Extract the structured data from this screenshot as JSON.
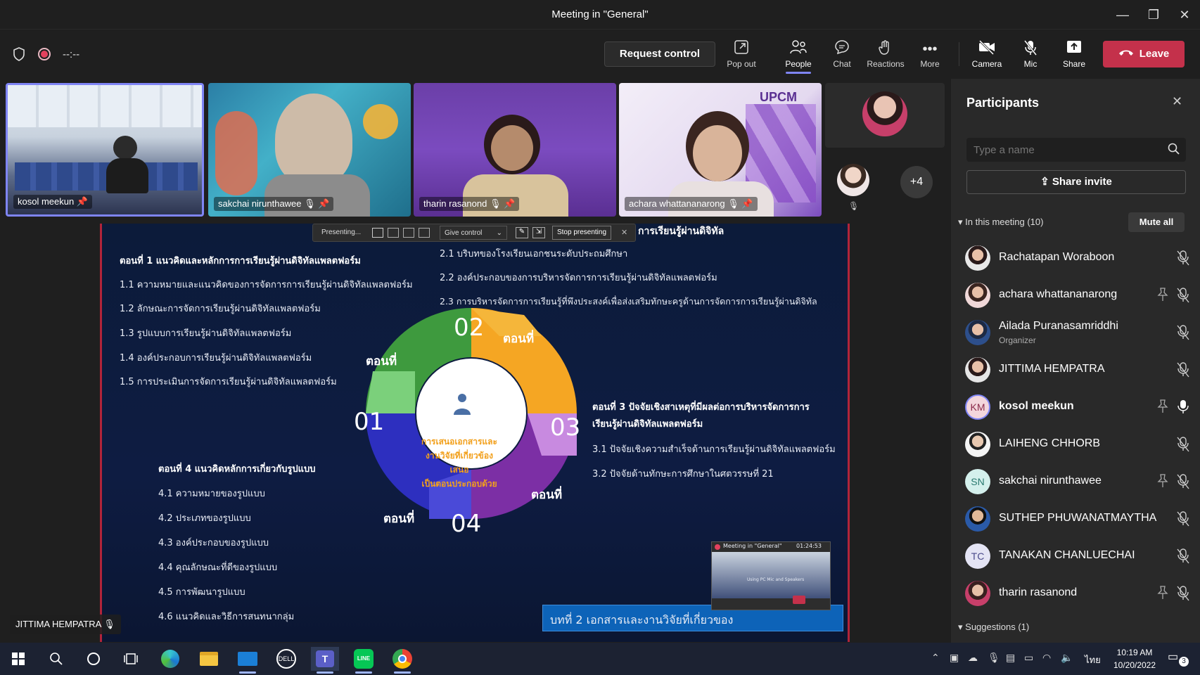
{
  "window": {
    "title": "Meeting in \"General\""
  },
  "toolbar": {
    "timer": "--:--",
    "request_control": "Request control",
    "pop_out": "Pop out",
    "people": "People",
    "chat": "Chat",
    "reactions": "Reactions",
    "more": "More",
    "camera": "Camera",
    "mic": "Mic",
    "share": "Share",
    "leave": "Leave",
    "colors": {
      "leave": "#c4314b",
      "accent": "#7f85f5"
    }
  },
  "videos": [
    {
      "name": "kosol meekun"
    },
    {
      "name": "sakchai nirunthawee"
    },
    {
      "name": "tharin rasanond"
    },
    {
      "name": "achara whattananarong"
    }
  ],
  "overflow_count": "+4",
  "presenting_bar": {
    "status": "Presenting...",
    "give_control": "Give control",
    "stop": "Stop presenting"
  },
  "slide": {
    "top_title": "การเรียนรู้ผ่านดิจิทัล",
    "part1_title": "ตอนที่ 1 แนวคิดและหลักการการเรียนรู้ผ่านดิจิทัลแพลตฟอร์ม",
    "part1_items": [
      "1.1 ความหมายและแนวคิดของการจัดการการเรียนรู้ผ่านดิจิทัลแพลตฟอร์ม",
      "1.2 ลักษณะการจัดการเรียนรู้ผ่านดิจิทัลแพลตฟอร์ม",
      "1.3 รูปแบบการเรียนรู้ผ่านดิจิทัลแพลตฟอร์ม",
      "1.4 องค์ประกอบการเรียนรู้ผ่านดิจิทัลแพลตฟอร์ม",
      "1.5 การประเมินการจัดการเรียนรู้ผ่านดิจิทัลแพลตฟอร์ม"
    ],
    "part2_items": [
      "2.1 บริบทของโรงเรียนเอกชนระดับประถมศึกษา",
      "2.2 องค์ประกอบของการบริหารจัดการการเรียนรู้ผ่านดิจิทัลแพลตฟอร์ม",
      "2.3 การบริหารจัดการการเรียนรู้ที่พึงประสงค์เพื่อส่งเสริมทักษะครูด้านการจัดการการเรียนรู้ผ่านดิจิทัล"
    ],
    "part3_title_line1": "ตอนที่ 3 ปัจจัยเชิงสาเหตุที่มีผลต่อการบริหารจัดการการ",
    "part3_title_line2": "เรียนรู้ผ่านดิจิทัลแพลตฟอร์ม",
    "part3_items": [
      "3.1 ปัจจัยเชิงความสำเร็จด้านการเรียนรู้ผ่านดิจิทัลแพลตฟอร์ม",
      "3.2 ปัจจัยด้านทักษะการศึกษาในศตวรรษที่ 21"
    ],
    "part4_title": "ตอนที่ 4 แนวคิดหลักการเกี่ยวกับรูปแบบ",
    "part4_items": [
      "4.1 ความหมายของรูปแบบ",
      "4.2 ประเภทของรูปแบบ",
      "4.3 องค์ประกอบของรูปแบบ",
      "4.4 คุณลักษณะที่ดีของรูปแบบ",
      "4.5 การพัฒนารูปแบบ",
      "4.6 แนวคิดและวิธีการสนทนากลุ่ม"
    ],
    "wheel_center_lines": [
      "การเสนอเอกสารและ",
      "งานวิจัยที่เกี่ยวข้องเสนอ",
      "เป็นตอนประกอบด้วย"
    ],
    "wheel_numbers": [
      "01",
      "02",
      "03",
      "04"
    ],
    "wheel_label": "ตอนที่",
    "footer_banner": "บทที่ 2 เอกสารและงานวิจัยที่เกี่ยวของ",
    "pip_title": "Meeting in \"General\"",
    "pip_time": "01:24:53",
    "pip_caption": "Using PC Mic and Speakers",
    "presenter_name": "JITTIMA HEMPATRA"
  },
  "panel": {
    "title": "Participants",
    "search_placeholder": "Type a name",
    "share_invite": "Share invite",
    "in_meeting": "In this meeting (10)",
    "mute_all": "Mute all",
    "participants": [
      {
        "name": "Rachatapan Woraboon",
        "sub": ""
      },
      {
        "name": "achara whattananarong",
        "sub": ""
      },
      {
        "name": "Ailada Puranasamriddhi",
        "sub": "Organizer"
      },
      {
        "name": "JITTIMA HEMPATRA",
        "sub": ""
      },
      {
        "name": "kosol meekun",
        "sub": "",
        "initials": "KM"
      },
      {
        "name": "LAIHENG CHHORB",
        "sub": ""
      },
      {
        "name": "sakchai nirunthawee",
        "sub": "",
        "initials": "SN"
      },
      {
        "name": "SUTHEP PHUWANATMAYTHA",
        "sub": ""
      },
      {
        "name": "TANAKAN CHANLUECHAI",
        "sub": "",
        "initials": "TC"
      },
      {
        "name": "tharin rasanond",
        "sub": ""
      }
    ],
    "suggestions": "Suggestions (1)"
  },
  "taskbar": {
    "time": "10:19 AM",
    "date": "10/20/2022",
    "lang": "ไทย",
    "notifications": "3"
  }
}
